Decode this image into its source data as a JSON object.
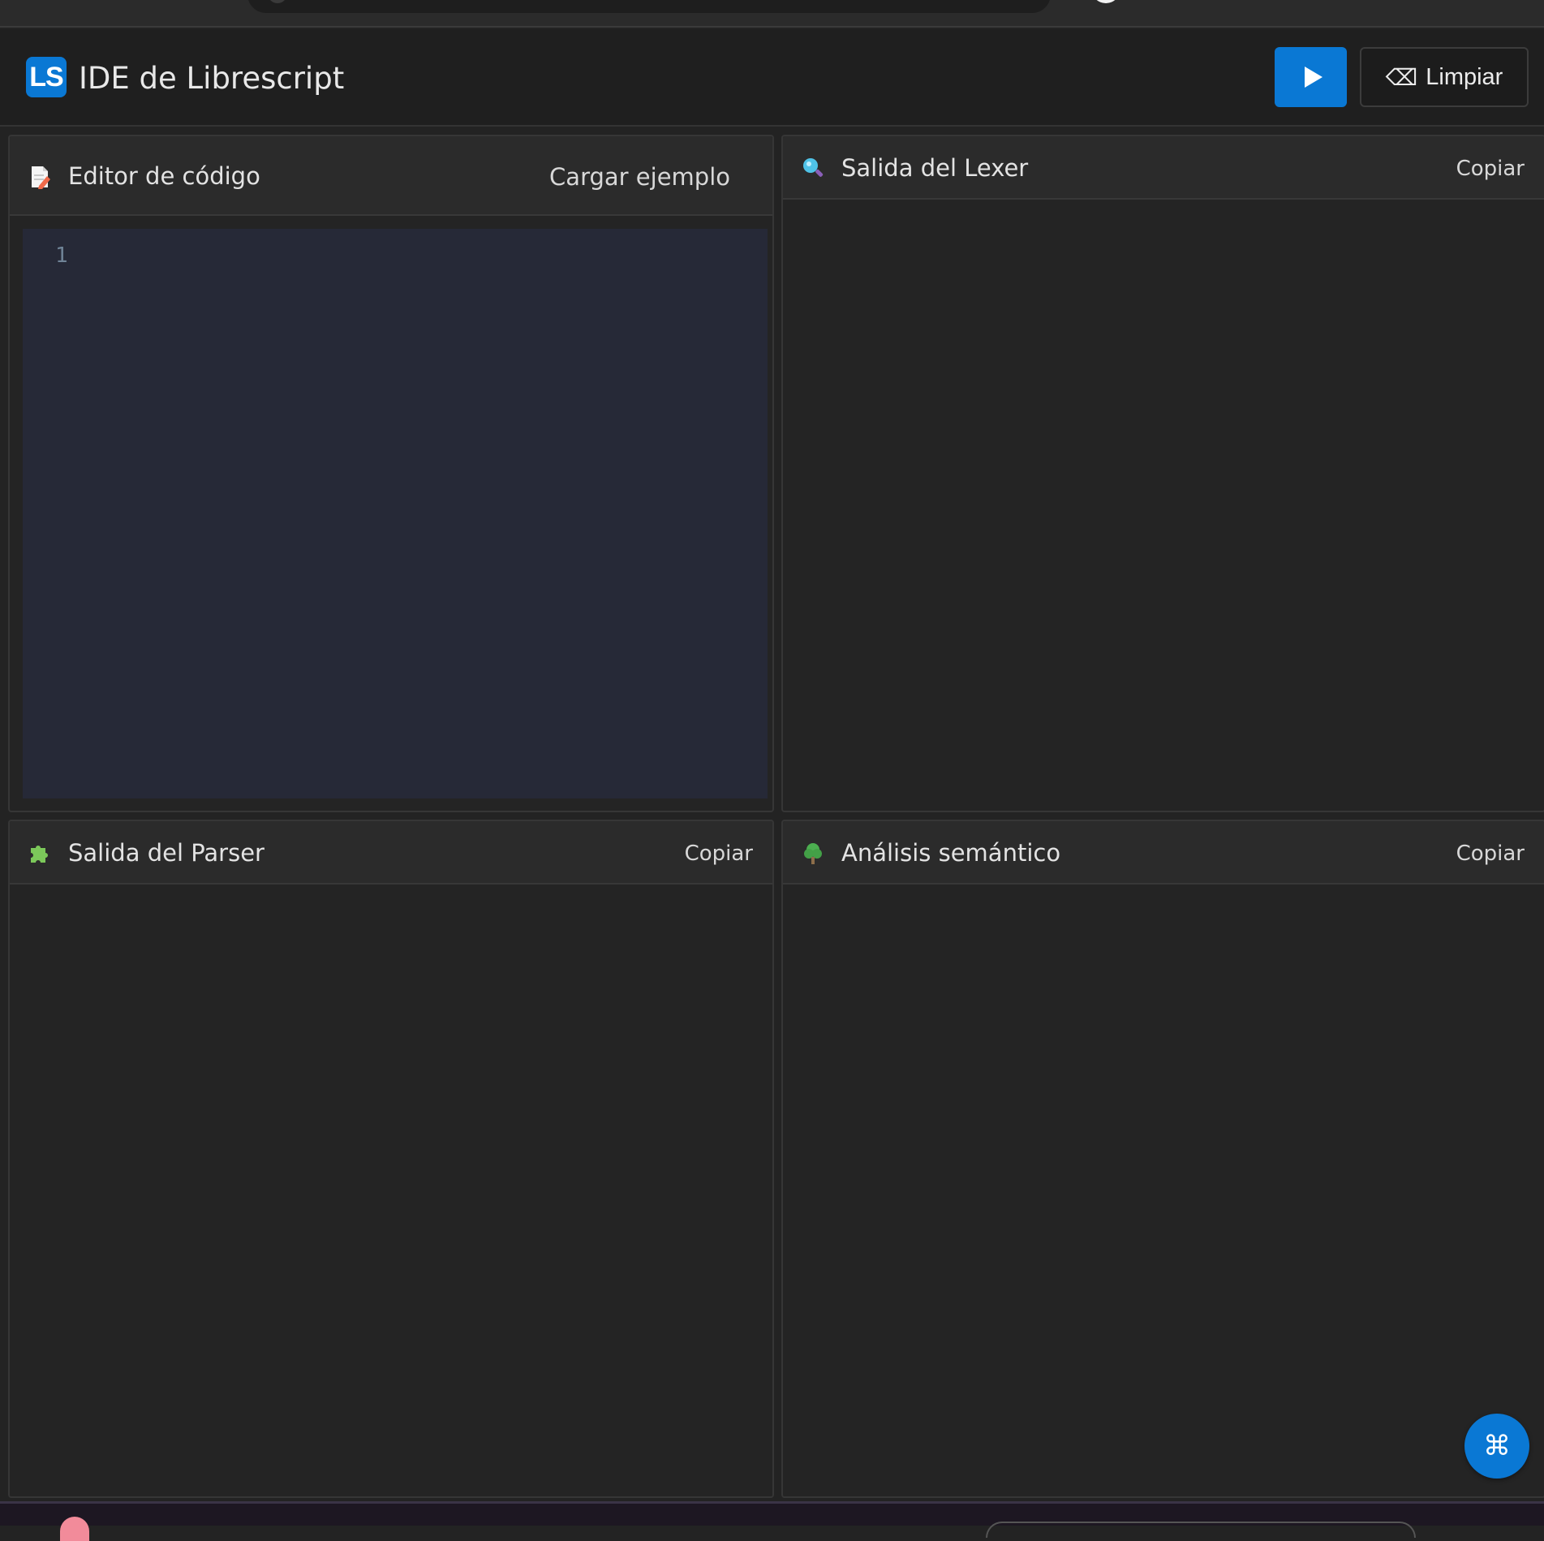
{
  "header": {
    "logo_text": "LS",
    "title": "IDE de Librescript",
    "clear_label": "Limpiar",
    "clear_icon_glyph": "⌫"
  },
  "panels": {
    "editor": {
      "title": "Editor de código",
      "action": "Cargar ejemplo",
      "line_numbers": [
        "1"
      ]
    },
    "lexer": {
      "title": "Salida del Lexer",
      "action": "Copiar"
    },
    "parser": {
      "title": "Salida del Parser",
      "action": "Copiar"
    },
    "semantic": {
      "title": "Análisis semántico",
      "action": "Copiar"
    }
  },
  "fab": {
    "glyph": "⌘"
  },
  "colors": {
    "accent": "#0a78d4",
    "background": "#232323",
    "panel_header": "#2b2b2b",
    "editor_background": "#262937"
  }
}
